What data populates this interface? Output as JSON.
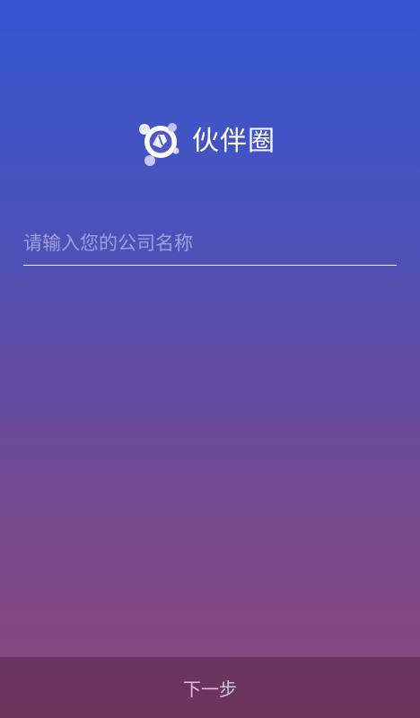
{
  "brand": {
    "name": "伙伴圈",
    "logo_icon": "people-circle-logo-icon"
  },
  "company_input": {
    "value": "",
    "placeholder": "请输入您的公司名称"
  },
  "footer": {
    "next_label": "下一步"
  },
  "colors": {
    "gradient_top": "#3457d1",
    "gradient_bottom": "#8c4679",
    "logo_light": "#d8d7ff",
    "text": "#ffffff"
  }
}
